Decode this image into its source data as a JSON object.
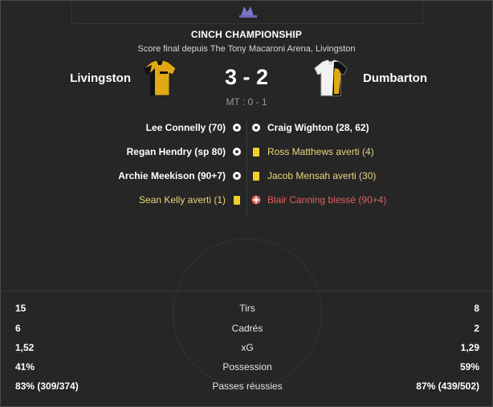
{
  "competition": {
    "name": "CINCH CHAMPIONSHIP"
  },
  "subtitle": "Score final depuis The Tony Macaroni Arena, Livingston",
  "home": {
    "name": "Livingston",
    "kit_colors": [
      "#e0a914",
      "#111111"
    ]
  },
  "away": {
    "name": "Dumbarton",
    "kit_colors": [
      "#f2f2f2",
      "#e0a914"
    ]
  },
  "score": "3 - 2",
  "halftime": "MT : 0 - 1",
  "events": {
    "home": [
      {
        "text": "Lee Connelly (70)",
        "type": "goal",
        "icon": "ball-icon"
      },
      {
        "text": "Regan Hendry (sp 80)",
        "type": "goal",
        "icon": "ball-icon"
      },
      {
        "text": "Archie Meekison (90+7)",
        "type": "goal",
        "icon": "ball-icon"
      },
      {
        "text": "Sean Kelly averti (1)",
        "type": "yellow",
        "icon": "yellow-card-icon"
      }
    ],
    "away": [
      {
        "text": "Craig Wighton (28, 62)",
        "type": "goal",
        "icon": "ball-icon"
      },
      {
        "text": "Ross Matthews averti (4)",
        "type": "yellow",
        "icon": "yellow-card-icon"
      },
      {
        "text": "Jacob Mensah averti (30)",
        "type": "yellow",
        "icon": "yellow-card-icon"
      },
      {
        "text": "Blair Canning blessé (90+4)",
        "type": "injury",
        "icon": "injury-cross-icon"
      }
    ]
  },
  "stats": [
    {
      "label": "Tirs",
      "home": "15",
      "away": "8"
    },
    {
      "label": "Cadrés",
      "home": "6",
      "away": "2"
    },
    {
      "label": "xG",
      "home": "1,52",
      "away": "1,29"
    },
    {
      "label": "Possession",
      "home": "41%",
      "away": "59%"
    },
    {
      "label": "Passes réussies",
      "home": "83% (309/374)",
      "away": "87% (439/502)"
    }
  ],
  "colors": {
    "goal": "#ffffff",
    "yellow_card": "#f2d02a",
    "injury": "#e0605c"
  }
}
